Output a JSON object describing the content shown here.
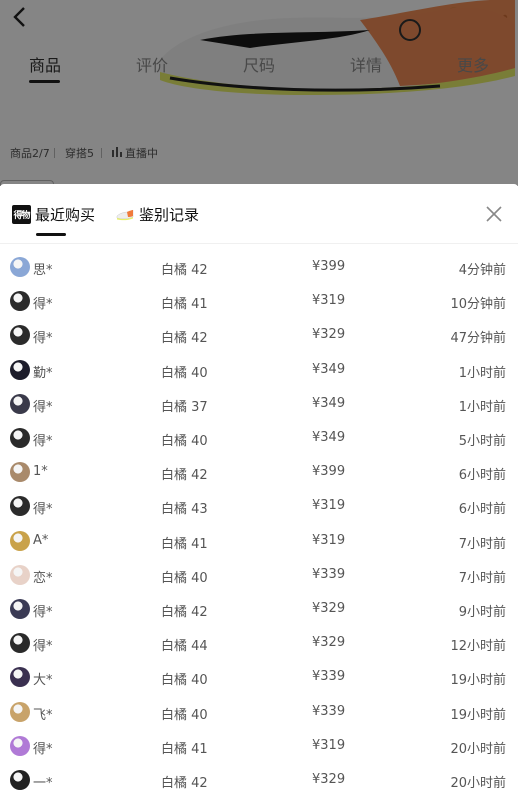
{
  "background_page": {
    "tabs": [
      "商品",
      "评价",
      "尺码",
      "详情",
      "更多"
    ],
    "active_tab_index": 0,
    "info": {
      "goods_label": "商品2/7",
      "outfit_label": "穿搭5",
      "live_label": "直播中"
    }
  },
  "sheet": {
    "tabs": {
      "recent_purchases": "最近购买",
      "verification_records": "鉴别记录"
    },
    "logo_text": "得物",
    "active_tab": "recent_purchases"
  },
  "records": [
    {
      "user": "思*",
      "size": "白橘 42",
      "price": "¥399",
      "time": "4分钟前",
      "avatar_color": "#8aa7d6"
    },
    {
      "user": "得*",
      "size": "白橘 41",
      "price": "¥319",
      "time": "10分钟前",
      "avatar_color": "#2b2b2b"
    },
    {
      "user": "得*",
      "size": "白橘 42",
      "price": "¥329",
      "time": "47分钟前",
      "avatar_color": "#2b2b2b"
    },
    {
      "user": "勤*",
      "size": "白橘 40",
      "price": "¥349",
      "time": "1小时前",
      "avatar_color": "#1c1c2a"
    },
    {
      "user": "得*",
      "size": "白橘 37",
      "price": "¥349",
      "time": "1小时前",
      "avatar_color": "#3a3a4a"
    },
    {
      "user": "得*",
      "size": "白橘 40",
      "price": "¥349",
      "time": "5小时前",
      "avatar_color": "#2a2a2a"
    },
    {
      "user": "1*",
      "size": "白橘 42",
      "price": "¥399",
      "time": "6小时前",
      "avatar_color": "#a98a6b"
    },
    {
      "user": "得*",
      "size": "白橘 43",
      "price": "¥319",
      "time": "6小时前",
      "avatar_color": "#2b2b2b"
    },
    {
      "user": "A*",
      "size": "白橘 41",
      "price": "¥319",
      "time": "7小时前",
      "avatar_color": "#c9a24a"
    },
    {
      "user": "恋*",
      "size": "白橘 40",
      "price": "¥339",
      "time": "7小时前",
      "avatar_color": "#e8d2c8"
    },
    {
      "user": "得*",
      "size": "白橘 42",
      "price": "¥329",
      "time": "9小时前",
      "avatar_color": "#3b3b55"
    },
    {
      "user": "得*",
      "size": "白橘 44",
      "price": "¥329",
      "time": "12小时前",
      "avatar_color": "#2a2a2a"
    },
    {
      "user": "大*",
      "size": "白橘 40",
      "price": "¥339",
      "time": "19小时前",
      "avatar_color": "#3a3050"
    },
    {
      "user": "飞*",
      "size": "白橘 40",
      "price": "¥339",
      "time": "19小时前",
      "avatar_color": "#c8a36a"
    },
    {
      "user": "得*",
      "size": "白橘 41",
      "price": "¥319",
      "time": "20小时前",
      "avatar_color": "#b07ad6"
    },
    {
      "user": "一*",
      "size": "白橘 42",
      "price": "¥329",
      "time": "20小时前",
      "avatar_color": "#222222"
    }
  ],
  "colors": {
    "overlay": "#000000",
    "shoe_accent": "#f07a3a",
    "shoe_sole": "#e9f06a",
    "text_primary": "#111111",
    "text_secondary": "#555555"
  }
}
